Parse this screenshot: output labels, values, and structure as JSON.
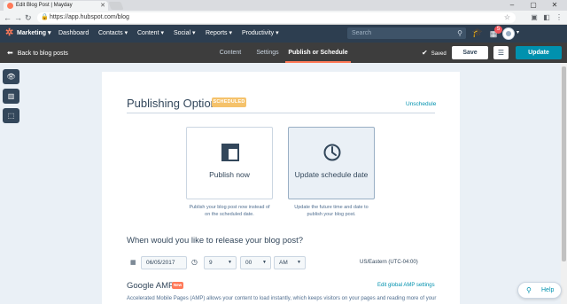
{
  "browser": {
    "tab_title": "Edit Blog Post | Mayday",
    "url": "https://app.hubspot.com/blog"
  },
  "topnav": {
    "brand": "Marketing",
    "items": [
      "Dashboard",
      "Contacts",
      "Content",
      "Social",
      "Reports",
      "Productivity"
    ],
    "search_placeholder": "Search",
    "notification_count": "5"
  },
  "editor_bar": {
    "back_label": "Back to blog posts",
    "tabs": [
      "Content",
      "Settings",
      "Publish or Schedule"
    ],
    "active_tab": "Publish or Schedule",
    "saved_label": "Saved",
    "save_label": "Save",
    "update_label": "Update"
  },
  "publishing": {
    "title": "Publishing Options",
    "status_badge": "SCHEDULED",
    "unschedule_label": "Unschedule",
    "option_publish": {
      "label": "Publish now",
      "description": "Publish your blog post now instead of on the scheduled date."
    },
    "option_schedule": {
      "label": "Update schedule date",
      "description": "Update the future time and date to publish your blog post."
    },
    "question": "When would you like to release your blog post?",
    "date": "06/05/2017",
    "hour": "9",
    "minute": "00",
    "ampm": "AM",
    "timezone": "US/Eastern (UTC-04:00)"
  },
  "amp": {
    "title": "Google AMP",
    "new_badge": "New",
    "settings_link": "Edit global AMP settings",
    "description": "Accelerated Mobile Pages (AMP) allows your content to load instantly, which keeps visitors on your pages and reading more of your"
  },
  "help": {
    "label": "Help"
  },
  "colors": {
    "accent": "#ff7a59",
    "primary": "#0091ae",
    "nav_bg": "#2d3e50",
    "badge_scheduled": "#f5c26b"
  }
}
